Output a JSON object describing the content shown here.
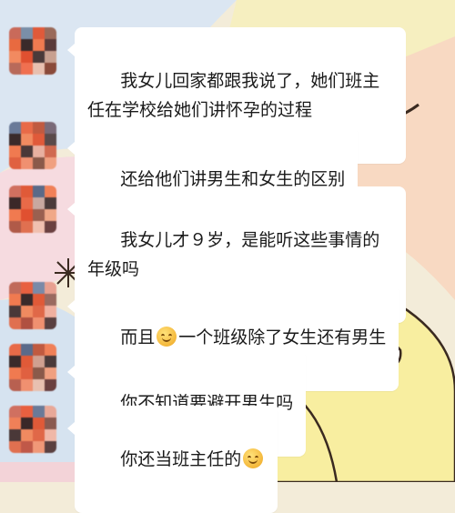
{
  "messages": [
    {
      "text": "我女儿回家都跟我说了，她们班主任在学校给她们讲怀孕的过程"
    },
    {
      "text": "还给他们讲男生和女生的区别"
    },
    {
      "text": "我女儿才９岁，是能听这些事情的年级吗"
    },
    {
      "text_before": "而且",
      "emoji": "smile-emoji",
      "text_after": "一个班级除了女生还有男生"
    },
    {
      "text": "你不知道要避开男生吗"
    },
    {
      "text_before": "你还当班主任的",
      "emoji": "smile-emoji"
    }
  ],
  "colors": {
    "background": "#f3ecd9",
    "bubble": "#ffffff",
    "text": "#1a1a1a",
    "sticker_yellow": "#f8eea0",
    "sticker_outline": "#3a2a20"
  }
}
